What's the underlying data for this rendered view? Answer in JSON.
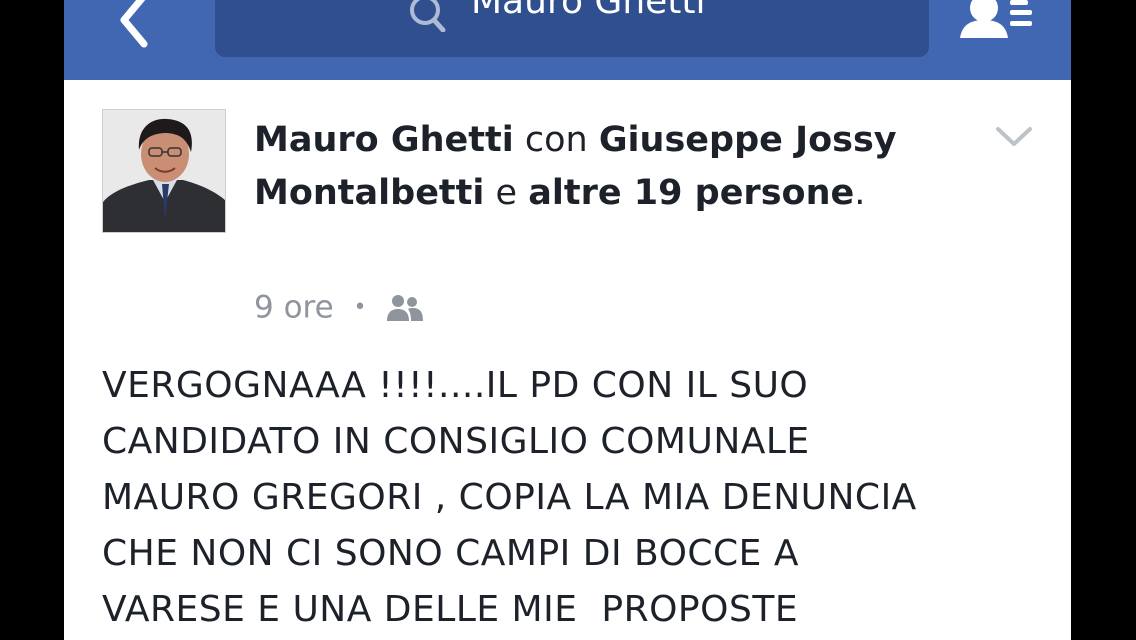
{
  "navbar": {
    "search_text": "Mauro Ghetti",
    "back_icon": "back-chevron-icon",
    "search_icon": "search-icon",
    "friends_icon": "friend-requests-icon",
    "color": "#4267b2",
    "search_bg": "#2f4f8f"
  },
  "post": {
    "author": "Mauro Ghetti",
    "with_word": "con",
    "tagged": "Giuseppe Jossy Montalbetti",
    "and_word": "e",
    "others": "altre 19 persone",
    "period": ".",
    "time": "9 ore",
    "separator": "•",
    "audience_icon": "friends-audience-icon",
    "menu_icon": "chevron-down-icon",
    "lines": [
      "VERGOGNAAA !!!!....IL PD CON IL SUO",
      "CANDIDATO IN CONSIGLIO COMUNALE",
      "MAURO GREGORI , COPIA LA MIA DENUNCIA",
      "CHE NON CI SONO CAMPI DI BOCCE A",
      "VARESE E UNA DELLE MIE  PROPOSTE"
    ]
  }
}
